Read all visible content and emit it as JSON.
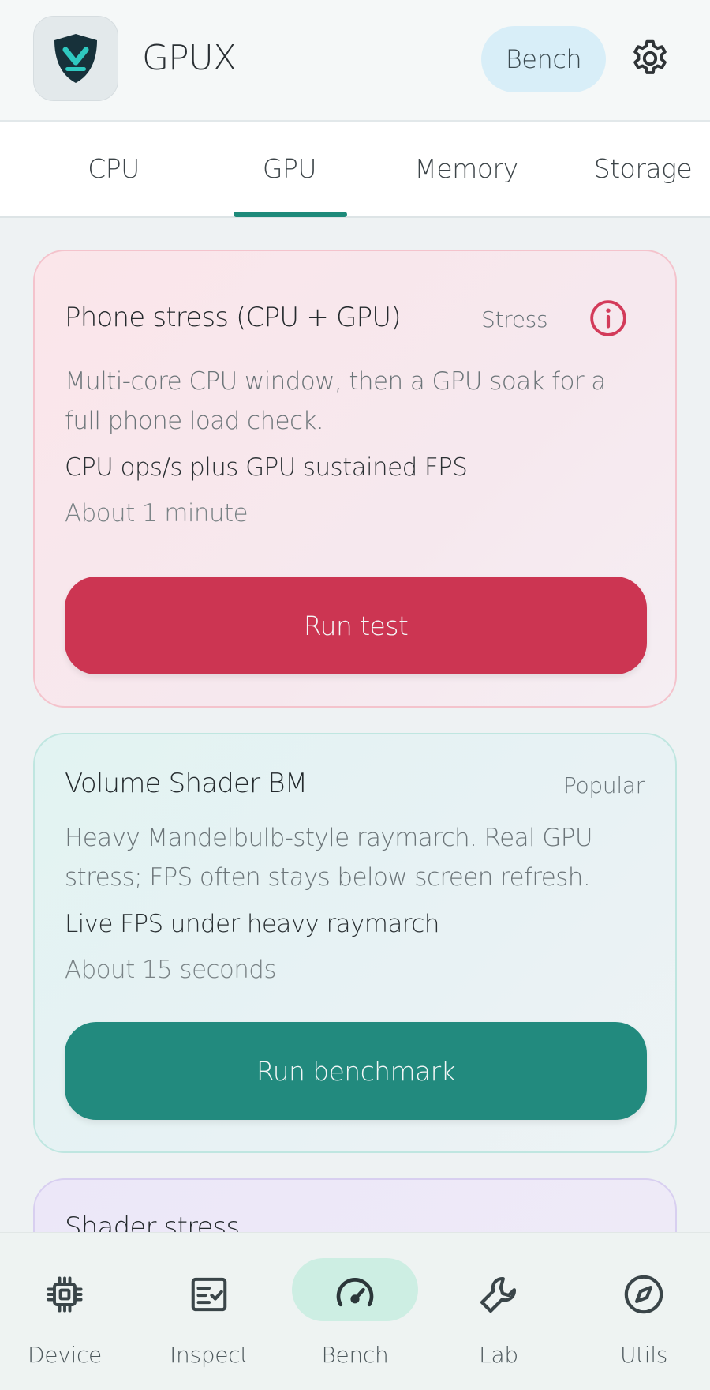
{
  "header": {
    "app_name": "GPUX",
    "mode_button": "Bench",
    "icons": {
      "logo": "shield-v-logo",
      "settings": "gear-icon"
    }
  },
  "tabs": {
    "items": [
      {
        "label": "CPU",
        "selected": false
      },
      {
        "label": "GPU",
        "selected": true
      },
      {
        "label": "Memory",
        "selected": false
      },
      {
        "label": "Storage",
        "selected": false
      }
    ],
    "accent": "#1e8a7a"
  },
  "cards": [
    {
      "title": "Phone stress (CPU + GPU)",
      "tag": "Stress",
      "description": "Multi-core CPU window, then a GPU soak for a full phone load check.",
      "metric": "CPU ops/s plus GPU sustained FPS",
      "duration": "About 1 minute",
      "button": "Run test",
      "has_info_icon": true,
      "accent": "#cc3552"
    },
    {
      "title": "Volume Shader BM",
      "tag": "Popular",
      "description": "Heavy Mandelbulb-style raymarch. Real GPU stress; FPS often stays below screen refresh.",
      "metric": "Live FPS under heavy raymarch",
      "duration": "About 15 seconds",
      "button": "Run benchmark",
      "accent": "#228a7e"
    },
    {
      "title": "Shader stress"
    }
  ],
  "bottom_nav": {
    "items": [
      {
        "label": "Device",
        "icon": "chip-icon",
        "selected": false
      },
      {
        "label": "Inspect",
        "icon": "checklist-icon",
        "selected": false
      },
      {
        "label": "Bench",
        "icon": "speedometer-icon",
        "selected": true
      },
      {
        "label": "Lab",
        "icon": "wrench-icon",
        "selected": false
      },
      {
        "label": "Utils",
        "icon": "compass-icon",
        "selected": false
      }
    ]
  }
}
